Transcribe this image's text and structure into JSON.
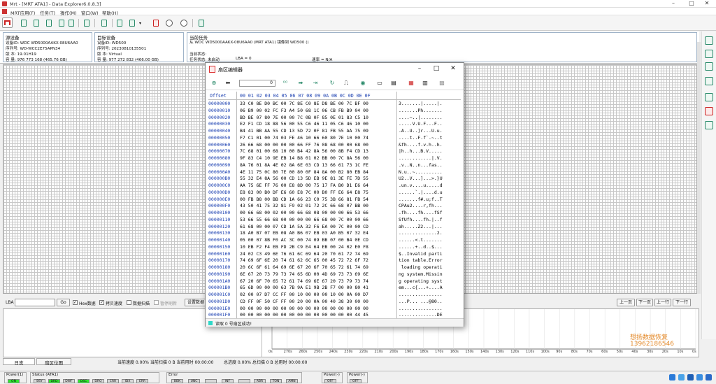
{
  "window": {
    "title": "Mrt - [MRT ATA1] - Data Explorer6.0.8.3]"
  },
  "menu": [
    "MRT应用(F)",
    "任务(T)",
    "操作(M)",
    "窗口(W)",
    "帮助(H)"
  ],
  "source": {
    "header": "源设备",
    "rows": [
      "设备ID: WDC WD5000AAKX-08U6AA0",
      "序列号: WD-WCC2E75APN34",
      "版  本: 19.01H19",
      "容  量: 976 773 168 (465.76 GB)"
    ]
  },
  "target": {
    "header": "目标设备",
    "rows": [
      "设备ID: WD500",
      "序列号: 20230810135501",
      "版  本: Virtual",
      "容  量: 977 272 832 (466.00 GB)"
    ]
  },
  "task": {
    "header": "当前任务",
    "line": "从 WDC WD5000AAKX-08U6AA0 (MRT ATA1) 镜像到 WD500 ()",
    "state_label": "当前状态:",
    "task_state": "任务状态: 未启动",
    "lba": "LBA = 0",
    "speed": "速率 = N/A"
  },
  "lbarow": {
    "lba_label": "LBA",
    "go": "Go",
    "hex_label": "Hex数据",
    "copy_label": "拷贝速度",
    "data_scan": "数据扫描",
    "stop": "暂停刷新",
    "set_data": "设置数据",
    "prev_page": "上一页",
    "next_page": "下一页",
    "prev_row": "上一行",
    "next_row": "下一行"
  },
  "chart": {
    "xticks": [
      "0s",
      "270s",
      "260s",
      "250s",
      "240s",
      "230s",
      "220s",
      "210s",
      "200s",
      "190s",
      "180s",
      "170s",
      "160s",
      "150s",
      "140s",
      "130s",
      "120s",
      "110s",
      "100s",
      "90s",
      "80s",
      "70s",
      "60s",
      "50s",
      "40s",
      "30s",
      "20s",
      "10s",
      "0s"
    ]
  },
  "watermark": [
    "想扬数据恢复",
    "13962186546"
  ],
  "tabs": [
    "日志",
    "扇区位图"
  ],
  "stats": [
    "当前速度 0.00% 当前扫描 0 B 当前用时 00:00:00",
    "总进度 0.00% 总扫描 0 B 总用时 00:00:00"
  ],
  "statusbar": {
    "groups": [
      {
        "h": "Power(1)",
        "leds": [
          {
            "t": "ON",
            "on": true
          }
        ]
      },
      {
        "h": "Status (ATA1)",
        "leds": [
          {
            "t": "BSY",
            "on": false
          },
          {
            "t": "DRD",
            "on": true
          },
          {
            "t": "DWF",
            "on": false
          },
          {
            "t": "DSC",
            "on": true
          },
          {
            "t": "DRQ",
            "on": false
          },
          {
            "t": "CRR",
            "on": false
          },
          {
            "t": "IDX",
            "on": false
          },
          {
            "t": "ERR",
            "on": false
          }
        ]
      },
      {
        "h": "Error",
        "leds": [
          {
            "t": "BBK",
            "on": false
          },
          {
            "t": "UNC",
            "on": false
          },
          {
            "t": "",
            "on": false
          },
          {
            "t": "INF",
            "on": false
          },
          {
            "t": "",
            "on": false
          },
          {
            "t": "ABR",
            "on": false
          },
          {
            "t": "TON",
            "on": false
          },
          {
            "t": "AMN",
            "on": false
          }
        ]
      },
      {
        "h": "Power(-)",
        "leds": [
          {
            "t": "OFF",
            "on": false
          }
        ]
      },
      {
        "h": "Power(-)",
        "leds": [
          {
            "t": "OFF",
            "on": false
          }
        ]
      }
    ]
  },
  "dialog": {
    "title": "扇区编辑器",
    "sector_input": "0",
    "status": "读取 0 号扇区成功!",
    "header": {
      "offset": "Offset",
      "cols": "00 01 02 03 04 05 06 07 08 09 0A 0B 0C 0D 0E 0F"
    },
    "rows": [
      {
        "o": "00000000",
        "h": "33 C0 8E D0 BC 00 7C 8E C0 8E D8 BE 00 7C BF 00",
        "a": "3.......|.....|."
      },
      {
        "o": "00000010",
        "h": "06 B9 00 02 FC F3 A4 50 68 1C 06 CB FB B9 04 00",
        "a": ".......Ph......."
      },
      {
        "o": "00000020",
        "h": "BD BE 07 80 7E 00 00 7C 0B 0F 85 0E 01 83 C5 10",
        "a": "....~..|........"
      },
      {
        "o": "00000030",
        "h": "E2 F1 CD 18 88 56 00 55 C6 46 11 05 C6 46 10 00",
        "a": ".....V.U.F...F.."
      },
      {
        "o": "00000040",
        "h": "B4 41 BB AA 55 CD 13 5D 72 0F 81 FB 55 AA 75 09",
        "a": ".A..U..]r...U.u."
      },
      {
        "o": "00000050",
        "h": "F7 C1 01 00 74 03 FE 46 10 66 60 80 7E 10 00 74",
        "a": "....t..F.f`.~..t"
      },
      {
        "o": "00000060",
        "h": "26 66 68 00 00 00 00 66 FF 76 08 68 00 00 68 00",
        "a": "&fh....f.v.h..h."
      },
      {
        "o": "00000070",
        "h": "7C 68 01 00 68 10 00 B4 42 8A 56 00 8B F4 CD 13",
        "a": "|h..h...B.V....."
      },
      {
        "o": "00000080",
        "h": "9F 83 C4 10 9E EB 14 B8 01 02 BB 00 7C 8A 56 00",
        "a": "............|.V."
      },
      {
        "o": "00000090",
        "h": "8A 76 01 8A 4E 02 8A 6E 03 CD 13 66 61 73 1C FE",
        "a": ".v..N..n...fas.."
      },
      {
        "o": "000000A0",
        "h": "4E 11 75 0C 80 7E 00 80 0F 84 8A 00 B2 80 EB 84",
        "a": "N.u..~.........."
      },
      {
        "o": "000000B0",
        "h": "55 32 E4 8A 56 00 CD 13 5D EB 9E 81 3E FE 7D 55",
        "a": "U2..V...]...>.}U"
      },
      {
        "o": "000000C0",
        "h": "AA 75 6E FF 76 00 E8 8D 00 75 17 FA B0 D1 E6 64",
        "a": ".un.v....u.....d"
      },
      {
        "o": "000000D0",
        "h": "E8 83 00 B0 DF E6 60 E8 7C 00 B0 FF E6 64 E8 75",
        "a": "......`.|....d.u"
      },
      {
        "o": "000000E0",
        "h": "00 FB B8 00 BB CD 1A 66 23 C0 75 3B 66 81 FB 54",
        "a": ".......f#.u;f..T"
      },
      {
        "o": "000000F0",
        "h": "43 50 41 75 32 81 F9 02 01 72 2C 66 68 07 BB 00",
        "a": "CPAu2....r,fh..."
      },
      {
        "o": "00000100",
        "h": "00 66 68 00 02 00 00 66 68 08 00 00 00 66 53 66",
        "a": ".fh....fh....fSf"
      },
      {
        "o": "00000110",
        "h": "53 66 55 66 68 00 00 00 00 66 68 00 7C 00 00 66",
        "a": "SfUfh....fh.|..f"
      },
      {
        "o": "00000120",
        "h": "61 68 00 00 07 CD 1A 5A 32 F6 EA 00 7C 00 00 CD",
        "a": "ah.....Z2...|..."
      },
      {
        "o": "00000130",
        "h": "18 A0 B7 07 EB 08 A0 B6 07 EB 03 A0 B5 07 32 E4",
        "a": "..............2."
      },
      {
        "o": "00000140",
        "h": "05 00 07 8B F0 AC 3C 00 74 09 BB 07 00 B4 0E CD",
        "a": "......<.t......."
      },
      {
        "o": "00000150",
        "h": "10 EB F2 F4 EB FD 2B C9 E4 64 EB 00 24 02 E0 F8",
        "a": "......+..d..$..."
      },
      {
        "o": "00000160",
        "h": "24 02 C3 49 6E 76 61 6C 69 64 20 70 61 72 74 69",
        "a": "$..Invalid parti"
      },
      {
        "o": "00000170",
        "h": "74 69 6F 6E 20 74 61 62 6C 65 00 45 72 72 6F 72",
        "a": "tion table.Error"
      },
      {
        "o": "00000180",
        "h": "20 6C 6F 61 64 69 6E 67 20 6F 70 65 72 61 74 69",
        "a": " loading operati"
      },
      {
        "o": "00000190",
        "h": "6E 67 20 73 79 73 74 65 6D 00 4D 69 73 73 69 6E",
        "a": "ng system.Missin"
      },
      {
        "o": "000001A0",
        "h": "67 20 6F 70 65 72 61 74 69 6E 67 20 73 79 73 74",
        "a": "g operating syst"
      },
      {
        "o": "000001B0",
        "h": "65 6D 00 00 00 63 7B 9A E1 9B 2B F7 00 00 80 41",
        "a": "em...c{...+....A"
      },
      {
        "o": "000001C0",
        "h": "02 00 07 D7 CC FF 00 10 00 00 00 10 00 0A 00 D7",
        "a": "................"
      },
      {
        "o": "000001D0",
        "h": "CD FF 0F 50 CF FF 00 20 00 0A 00 40 38 30 00 00",
        "a": "...P... ...@80.."
      },
      {
        "o": "000001E0",
        "h": "00 00 00 00 00 00 00 00 00 00 00 00 00 00 00 00",
        "a": "................"
      },
      {
        "o": "000001F0",
        "h": "00 00 00 00 00 00 00 00 00 00 00 00 00 00 44 45",
        "a": "..............DE"
      }
    ]
  }
}
